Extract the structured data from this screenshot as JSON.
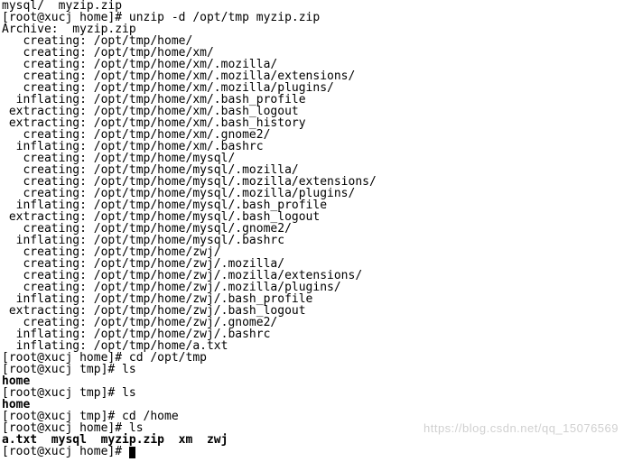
{
  "colors": {
    "bg": "#ffffff",
    "fg": "#000000",
    "watermark": "#d0d0d0",
    "cursor": "#000000"
  },
  "watermark": "https://blog.csdn.net/qq_15076569",
  "lines": [
    {
      "text": "mysql/  myzip.zip",
      "bold": false
    },
    {
      "text": "[root@xucj home]# unzip -d /opt/tmp myzip.zip",
      "bold": false
    },
    {
      "text": "Archive:  myzip.zip",
      "bold": false
    },
    {
      "text": "   creating: /opt/tmp/home/",
      "bold": false
    },
    {
      "text": "   creating: /opt/tmp/home/xm/",
      "bold": false
    },
    {
      "text": "   creating: /opt/tmp/home/xm/.mozilla/",
      "bold": false
    },
    {
      "text": "   creating: /opt/tmp/home/xm/.mozilla/extensions/",
      "bold": false
    },
    {
      "text": "   creating: /opt/tmp/home/xm/.mozilla/plugins/",
      "bold": false
    },
    {
      "text": "  inflating: /opt/tmp/home/xm/.bash_profile",
      "bold": false
    },
    {
      "text": " extracting: /opt/tmp/home/xm/.bash_logout",
      "bold": false
    },
    {
      "text": " extracting: /opt/tmp/home/xm/.bash_history",
      "bold": false
    },
    {
      "text": "   creating: /opt/tmp/home/xm/.gnome2/",
      "bold": false
    },
    {
      "text": "  inflating: /opt/tmp/home/xm/.bashrc",
      "bold": false
    },
    {
      "text": "   creating: /opt/tmp/home/mysql/",
      "bold": false
    },
    {
      "text": "   creating: /opt/tmp/home/mysql/.mozilla/",
      "bold": false
    },
    {
      "text": "   creating: /opt/tmp/home/mysql/.mozilla/extensions/",
      "bold": false
    },
    {
      "text": "   creating: /opt/tmp/home/mysql/.mozilla/plugins/",
      "bold": false
    },
    {
      "text": "  inflating: /opt/tmp/home/mysql/.bash_profile",
      "bold": false
    },
    {
      "text": " extracting: /opt/tmp/home/mysql/.bash_logout",
      "bold": false
    },
    {
      "text": "   creating: /opt/tmp/home/mysql/.gnome2/",
      "bold": false
    },
    {
      "text": "  inflating: /opt/tmp/home/mysql/.bashrc",
      "bold": false
    },
    {
      "text": "   creating: /opt/tmp/home/zwj/",
      "bold": false
    },
    {
      "text": "   creating: /opt/tmp/home/zwj/.mozilla/",
      "bold": false
    },
    {
      "text": "   creating: /opt/tmp/home/zwj/.mozilla/extensions/",
      "bold": false
    },
    {
      "text": "   creating: /opt/tmp/home/zwj/.mozilla/plugins/",
      "bold": false
    },
    {
      "text": "  inflating: /opt/tmp/home/zwj/.bash_profile",
      "bold": false
    },
    {
      "text": " extracting: /opt/tmp/home/zwj/.bash_logout",
      "bold": false
    },
    {
      "text": "   creating: /opt/tmp/home/zwj/.gnome2/",
      "bold": false
    },
    {
      "text": "  inflating: /opt/tmp/home/zwj/.bashrc",
      "bold": false
    },
    {
      "text": "  inflating: /opt/tmp/home/a.txt",
      "bold": false
    },
    {
      "text": "[root@xucj home]# cd /opt/tmp",
      "bold": false
    },
    {
      "text": "[root@xucj tmp]# ls",
      "bold": false
    },
    {
      "text": "home",
      "bold": true
    },
    {
      "text": "[root@xucj tmp]# ls",
      "bold": false
    },
    {
      "text": "home",
      "bold": true
    },
    {
      "text": "[root@xucj tmp]# cd /home",
      "bold": false
    },
    {
      "text": "[root@xucj home]# ls",
      "bold": false
    },
    {
      "text": "a.txt  mysql  myzip.zip  xm  zwj",
      "bold": true
    },
    {
      "text": "[root@xucj home]# ",
      "bold": false,
      "cursor": true
    }
  ]
}
